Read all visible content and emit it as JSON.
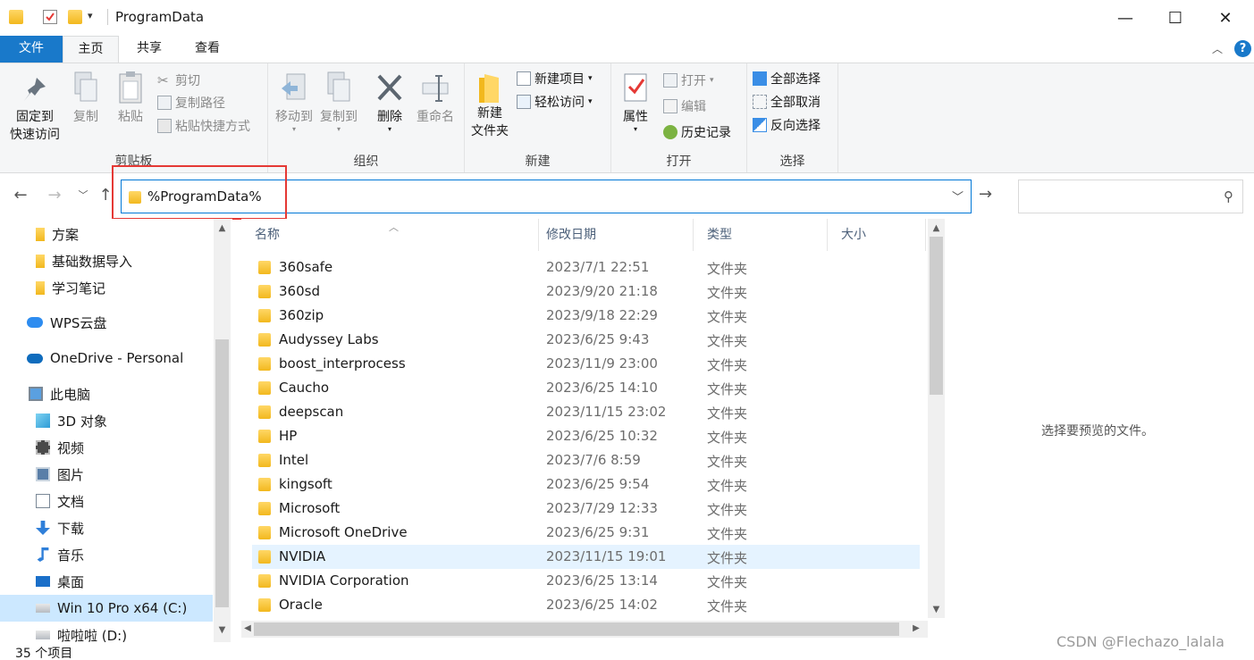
{
  "window": {
    "title": "ProgramData",
    "minimize": "—",
    "maximize": "☐",
    "close": "✕"
  },
  "tabs": [
    "文件",
    "主页",
    "共享",
    "查看"
  ],
  "ribbon": {
    "clipboard": {
      "pin_line1": "固定到",
      "pin_line2": "快速访问",
      "copy": "复制",
      "paste": "粘贴",
      "cut": "剪切",
      "copy_path": "复制路径",
      "paste_shortcut": "粘贴快捷方式",
      "label": "剪贴板"
    },
    "organize": {
      "move_to": "移动到",
      "copy_to": "复制到",
      "delete": "删除",
      "rename": "重命名",
      "label": "组织"
    },
    "new": {
      "new_folder_line1": "新建",
      "new_folder_line2": "文件夹",
      "new_item": "新建项目",
      "easy_access": "轻松访问",
      "label": "新建"
    },
    "open": {
      "properties": "属性",
      "open": "打开",
      "edit": "编辑",
      "history": "历史记录",
      "label": "打开"
    },
    "select": {
      "select_all": "全部选择",
      "select_none": "全部取消",
      "invert": "反向选择",
      "label": "选择"
    }
  },
  "address": {
    "path": "%ProgramData%",
    "dropdown": "﹀",
    "go": "→",
    "search_placeholder": ""
  },
  "nav_pane": [
    {
      "label": "方案",
      "icon": "folder-icon"
    },
    {
      "label": "基础数据导入",
      "icon": "folder-icon"
    },
    {
      "label": "学习笔记",
      "icon": "folder-icon"
    },
    {
      "label": "WPS云盘",
      "icon": "cloud-icon"
    },
    {
      "label": "OneDrive - Personal",
      "icon": "onedrive-icon"
    },
    {
      "label": "此电脑",
      "icon": "computer-icon"
    },
    {
      "label": "3D 对象",
      "icon": "3d-objects-icon"
    },
    {
      "label": "视频",
      "icon": "video-icon"
    },
    {
      "label": "图片",
      "icon": "pictures-icon"
    },
    {
      "label": "文档",
      "icon": "documents-icon"
    },
    {
      "label": "下载",
      "icon": "download-icon"
    },
    {
      "label": "音乐",
      "icon": "music-icon"
    },
    {
      "label": "桌面",
      "icon": "desktop-icon"
    },
    {
      "label": "Win 10 Pro x64 (C:)",
      "icon": "drive-icon"
    },
    {
      "label": "啦啦啦 (D:)",
      "icon": "drive-icon"
    }
  ],
  "columns": {
    "name": "名称",
    "date": "修改日期",
    "type": "类型",
    "size": "大小"
  },
  "files": [
    {
      "name": "360safe",
      "date": "2023/7/1 22:51",
      "type": "文件夹"
    },
    {
      "name": "360sd",
      "date": "2023/9/20 21:18",
      "type": "文件夹"
    },
    {
      "name": "360zip",
      "date": "2023/9/18 22:29",
      "type": "文件夹"
    },
    {
      "name": "Audyssey Labs",
      "date": "2023/6/25 9:43",
      "type": "文件夹"
    },
    {
      "name": "boost_interprocess",
      "date": "2023/11/9 23:00",
      "type": "文件夹"
    },
    {
      "name": "Caucho",
      "date": "2023/6/25 14:10",
      "type": "文件夹"
    },
    {
      "name": "deepscan",
      "date": "2023/11/15 23:02",
      "type": "文件夹"
    },
    {
      "name": "HP",
      "date": "2023/6/25 10:32",
      "type": "文件夹"
    },
    {
      "name": "Intel",
      "date": "2023/7/6 8:59",
      "type": "文件夹"
    },
    {
      "name": "kingsoft",
      "date": "2023/6/25 9:54",
      "type": "文件夹"
    },
    {
      "name": "Microsoft",
      "date": "2023/7/29 12:33",
      "type": "文件夹"
    },
    {
      "name": "Microsoft OneDrive",
      "date": "2023/6/25 9:31",
      "type": "文件夹"
    },
    {
      "name": "NVIDIA",
      "date": "2023/11/15 19:01",
      "type": "文件夹"
    },
    {
      "name": "NVIDIA Corporation",
      "date": "2023/6/25 13:14",
      "type": "文件夹"
    },
    {
      "name": "Oracle",
      "date": "2023/6/25 14:02",
      "type": "文件夹"
    }
  ],
  "preview_text": "选择要预览的文件。",
  "status": {
    "count": "35 个项目",
    "watermark": "CSDN @Flechazo_lalala"
  },
  "colors": {
    "accent": "#1979ca",
    "highlight_box": "#e53935",
    "selection": "#e5f3ff",
    "folder": "#f2b81e"
  }
}
